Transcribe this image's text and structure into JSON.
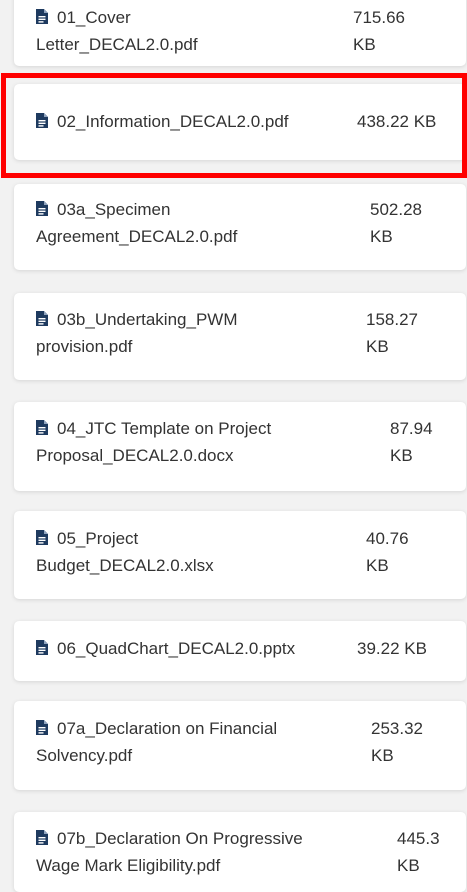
{
  "files": [
    {
      "line1": "01_Cover",
      "line2": "Letter_DECAL2.0.pdf",
      "size1": "715.66",
      "size2": "KB"
    },
    {
      "line1": "02_Information_DECAL2.0.pdf",
      "line2": "",
      "size1": "438.22 KB",
      "size2": ""
    },
    {
      "line1": "03a_Specimen",
      "line2": "Agreement_DECAL2.0.pdf",
      "size1": "502.28",
      "size2": "KB"
    },
    {
      "line1": "03b_Undertaking_PWM",
      "line2": "provision.pdf",
      "size1": "158.27",
      "size2": "KB"
    },
    {
      "line1": "04_JTC Template on Project",
      "line2": "Proposal_DECAL2.0.docx",
      "size1": "87.94",
      "size2": "KB"
    },
    {
      "line1": "05_Project",
      "line2": "Budget_DECAL2.0.xlsx",
      "size1": "40.76",
      "size2": "KB"
    },
    {
      "line1": "06_QuadChart_DECAL2.0.pptx",
      "line2": "",
      "size1": "39.22 KB",
      "size2": ""
    },
    {
      "line1": "07a_Declaration on Financial",
      "line2": "Solvency.pdf",
      "size1": "253.32",
      "size2": "KB"
    },
    {
      "line1": "07b_Declaration On Progressive",
      "line2": "Wage Mark Eligibility.pdf",
      "size1": "445.3",
      "size2": "KB"
    }
  ],
  "colors": {
    "icon": "#1e3a5f",
    "highlight": "#ff0000",
    "card": "#ffffff",
    "background": "#f2f2f2"
  }
}
